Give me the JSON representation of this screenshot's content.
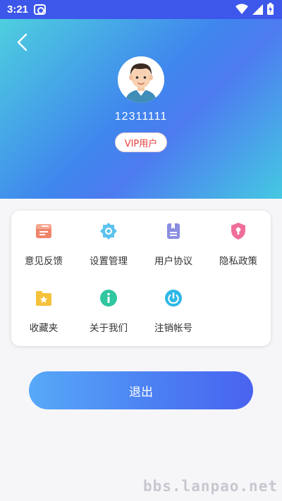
{
  "status_bar": {
    "time": "3:21",
    "icons": [
      "notification-app-icon",
      "wifi-icon",
      "signal-icon",
      "battery-icon"
    ]
  },
  "header": {
    "back_icon": "chevron-left-icon",
    "username": "12311111",
    "badge": "VIP用户"
  },
  "menu": {
    "items": [
      {
        "label": "意见反馈",
        "icon": "feedback-icon",
        "color": "#f0846a"
      },
      {
        "label": "设置管理",
        "icon": "settings-gear-icon",
        "color": "#5cc3ef"
      },
      {
        "label": "用户协议",
        "icon": "document-icon",
        "color": "#8a8ee0"
      },
      {
        "label": "隐私政策",
        "icon": "shield-lock-icon",
        "color": "#ef6f9a"
      },
      {
        "label": "收藏夹",
        "icon": "folder-star-icon",
        "color": "#f6c23c"
      },
      {
        "label": "关于我们",
        "icon": "info-icon",
        "color": "#2fc6a0"
      },
      {
        "label": "注销帐号",
        "icon": "power-icon",
        "color": "#2fb8e8"
      }
    ]
  },
  "logout_label": "退出",
  "watermark": "bbs.lanpao.net",
  "colors": {
    "status_bar": "#3d57ea",
    "vip_text": "#e5413d",
    "logout_start": "#57a9f8",
    "logout_end": "#4a63f0"
  }
}
